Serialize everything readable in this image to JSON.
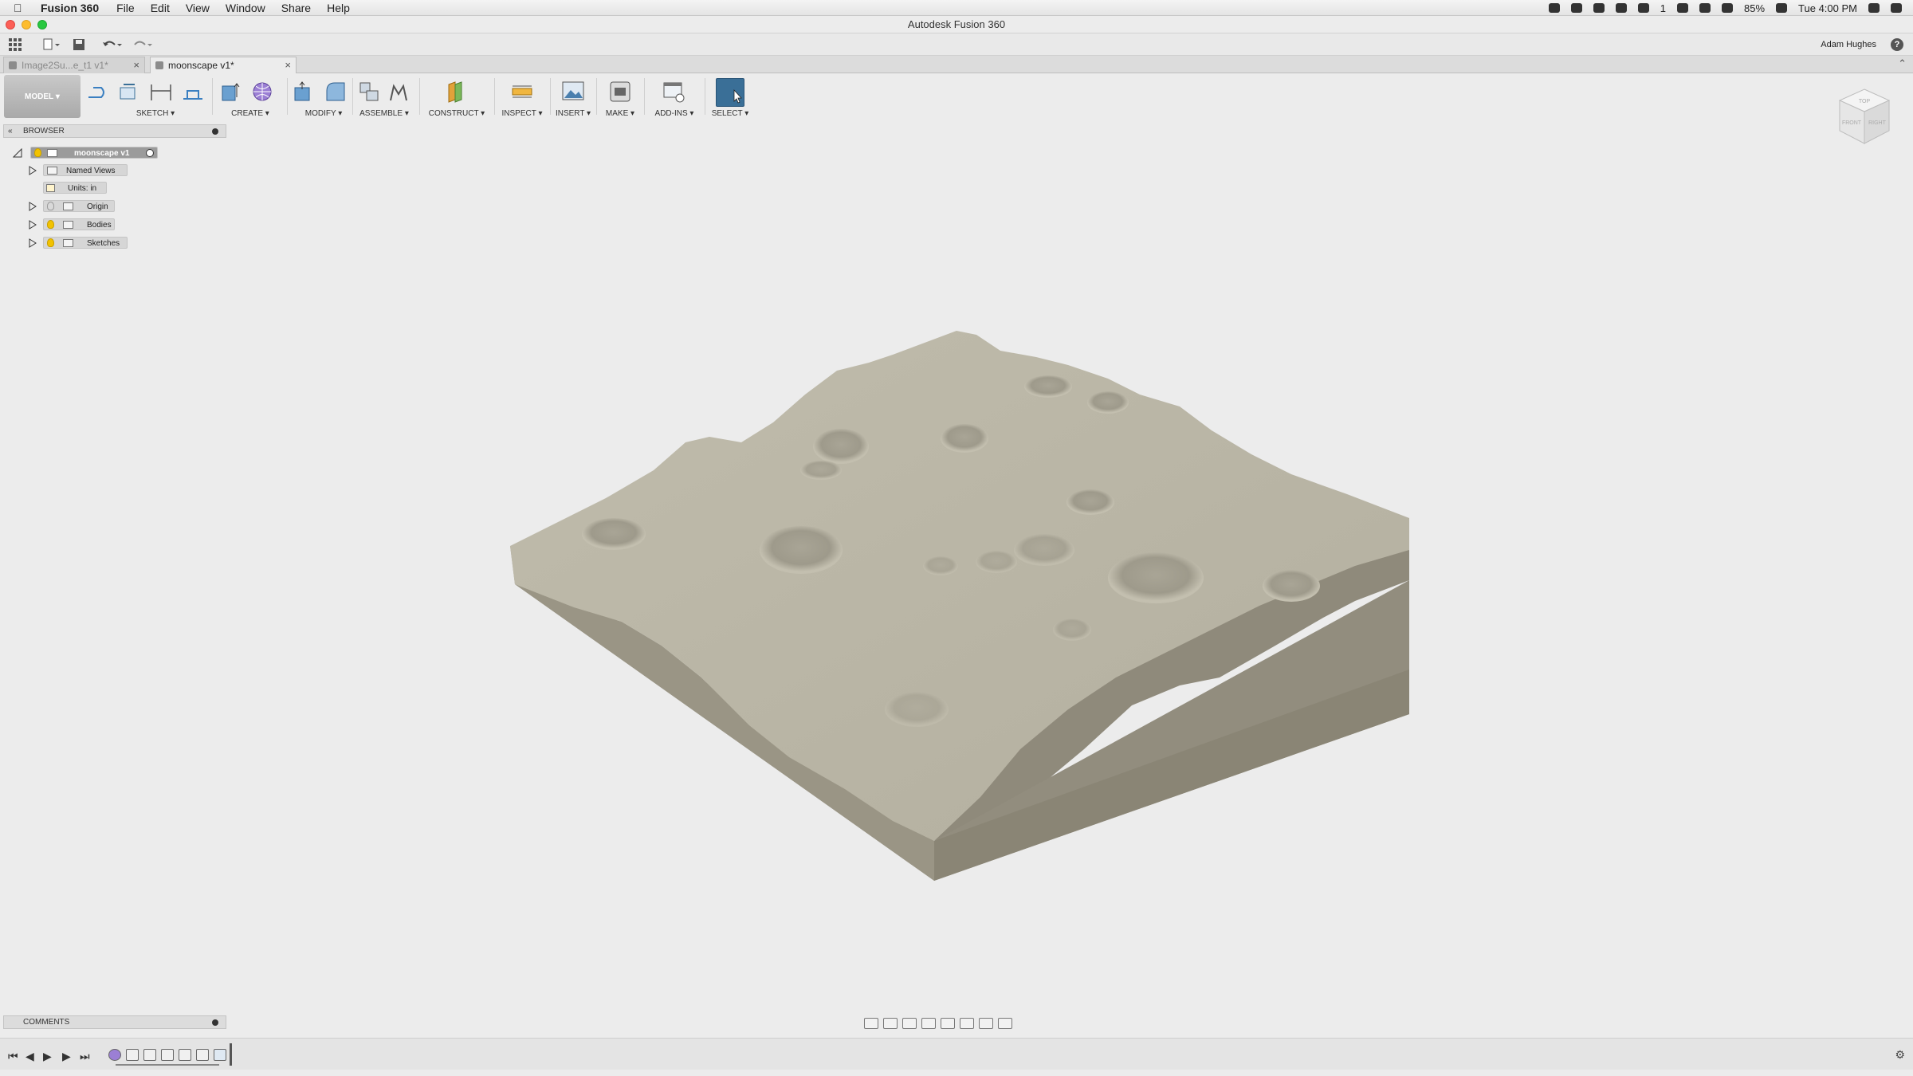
{
  "menubar": {
    "app_name": "Fusion 360",
    "items": [
      "File",
      "Edit",
      "View",
      "Window",
      "Share",
      "Help"
    ],
    "status": {
      "notification_count": "1",
      "battery": "85%",
      "clock": "Tue 4:00 PM"
    }
  },
  "window": {
    "title": "Autodesk Fusion 360"
  },
  "qat": {
    "user": "Adam Hughes",
    "help": "?"
  },
  "tabs": [
    {
      "label": "Image2Su...e_t1 v1*",
      "active": false
    },
    {
      "label": "moonscape v1*",
      "active": true
    }
  ],
  "toolbar": {
    "workspace": "MODEL",
    "groups": [
      {
        "label": "SKETCH"
      },
      {
        "label": "CREATE"
      },
      {
        "label": "MODIFY"
      },
      {
        "label": "ASSEMBLE"
      },
      {
        "label": "CONSTRUCT"
      },
      {
        "label": "INSPECT"
      },
      {
        "label": "INSERT"
      },
      {
        "label": "MAKE"
      },
      {
        "label": "ADD-INS"
      },
      {
        "label": "SELECT"
      }
    ]
  },
  "browser": {
    "title": "BROWSER",
    "root": "moonscape v1",
    "nodes": [
      "Named Views",
      "Units: in",
      "Origin",
      "Bodies",
      "Sketches"
    ]
  },
  "viewcube": {
    "top": "TOP",
    "front": "FRONT",
    "right": "RIGHT"
  },
  "comments": {
    "title": "COMMENTS"
  },
  "colors": {
    "terrain_top": "#bab6a6",
    "terrain_side_left": "#a19c8c",
    "terrain_side_right": "#8f8a7b",
    "select_accent": "#3a6f97",
    "background": "#ececec"
  }
}
